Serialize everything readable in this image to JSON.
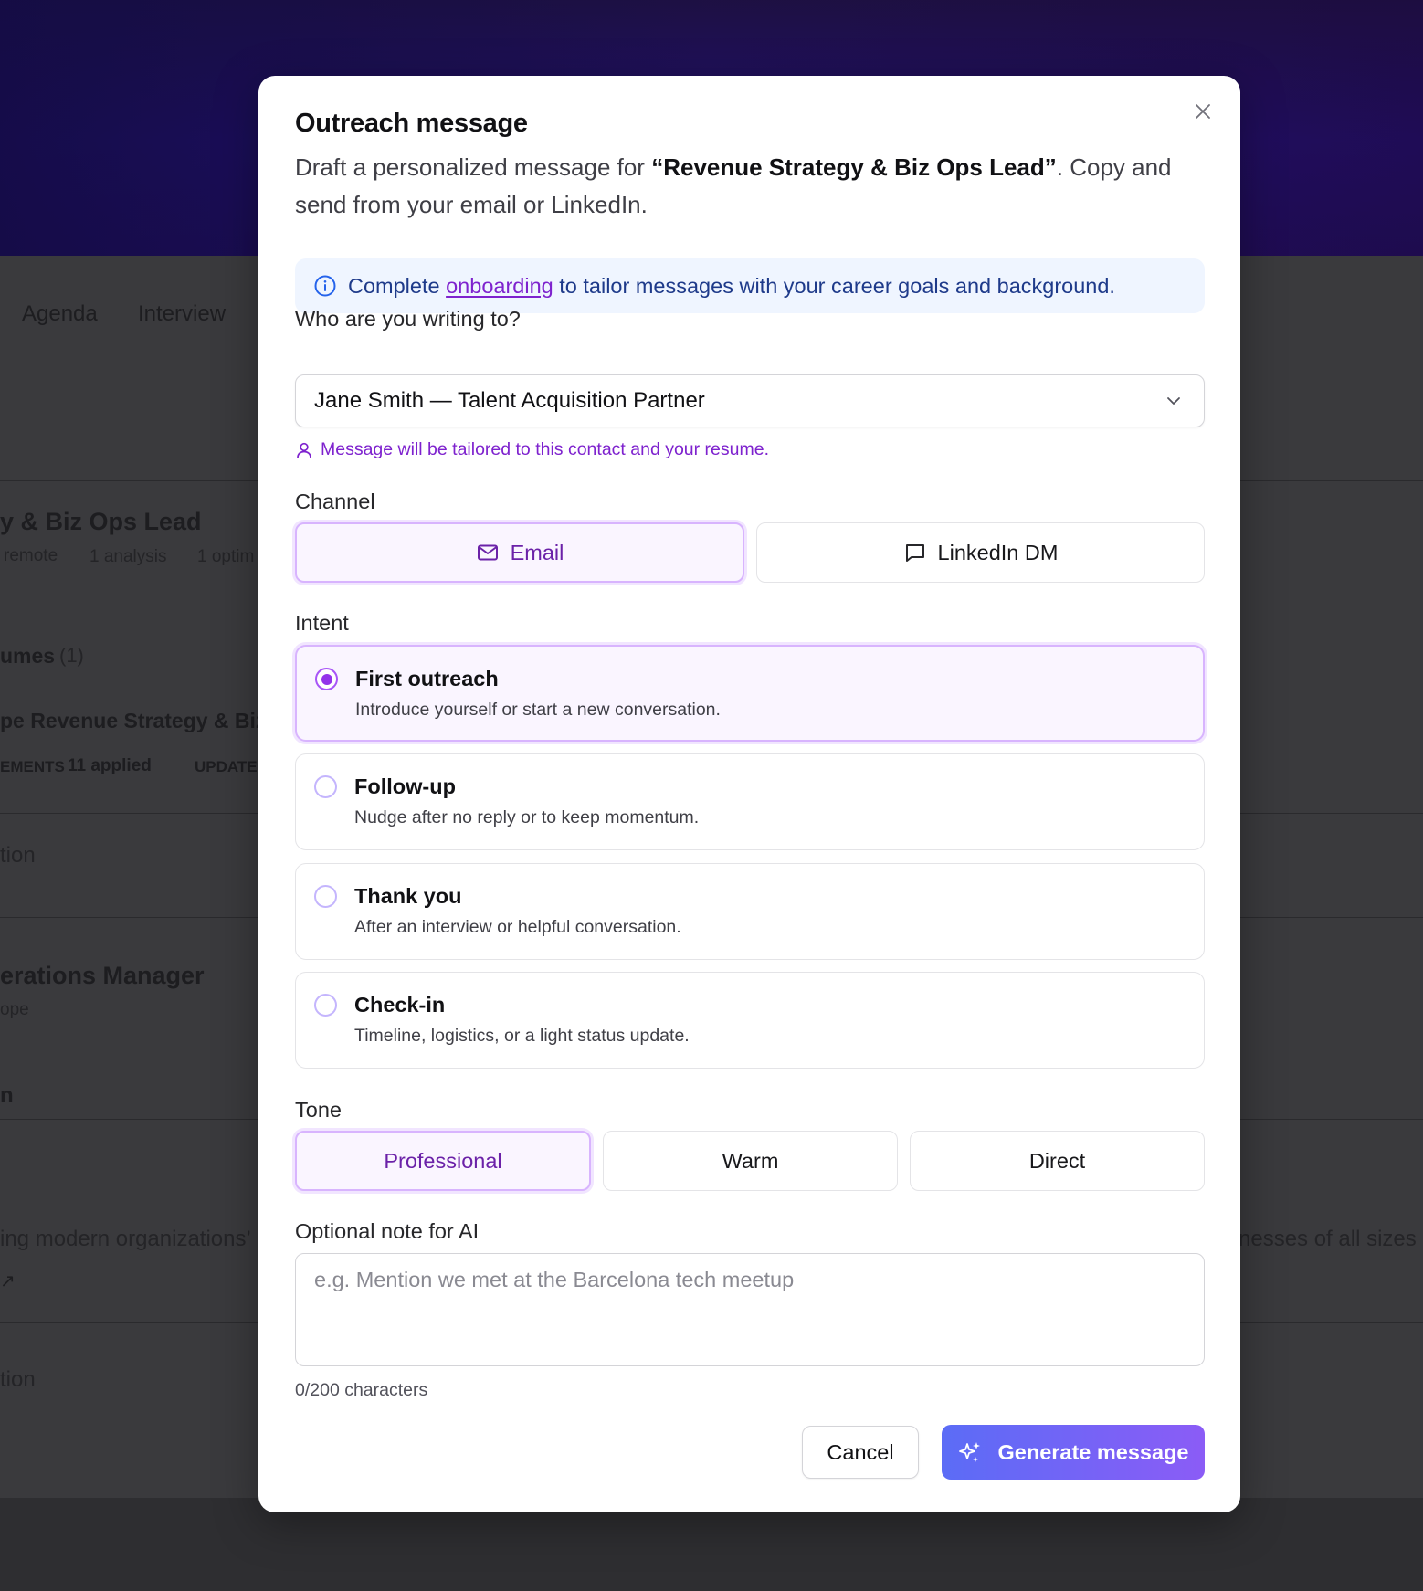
{
  "background": {
    "tabs": [
      "Agenda",
      "Interview"
    ],
    "job_title": "y & Biz Ops Lead",
    "meta": [
      "remote",
      "1 analysis",
      "1 optim"
    ],
    "resumes_heading": "umes",
    "resumes_count": "(1)",
    "resume_title": "pe Revenue Strategy & Biz",
    "enhancements_label": "EMENTS",
    "enhancements_value": "11 applied",
    "updated_label": "UPDATE",
    "section_a": "tion",
    "role2_title": "erations Manager",
    "role2_sub": "ope",
    "section_b": "n",
    "blurb_left": "ing modern organizations’",
    "blurb_right": "nesses of all sizes",
    "section_c": "tion"
  },
  "modal": {
    "title": "Outreach message",
    "description_pre": "Draft a personalized message for ",
    "description_role": "“Revenue Strategy & Biz Ops Lead”",
    "description_post": ". Copy and send from your email or LinkedIn.",
    "info": {
      "pre": "Complete ",
      "link": "onboarding",
      "post": " to tailor messages with your career goals and background."
    },
    "recipient": {
      "label": "Who are you writing to?",
      "value": "Jane Smith — Talent Acquisition Partner",
      "hint": "Message will be tailored to this contact and your resume."
    },
    "channel": {
      "label": "Channel",
      "options": [
        {
          "label": "Email",
          "icon": "mail-icon",
          "selected": true
        },
        {
          "label": "LinkedIn DM",
          "icon": "message-square-icon",
          "selected": false
        }
      ]
    },
    "intent": {
      "label": "Intent",
      "options": [
        {
          "title": "First outreach",
          "desc": "Introduce yourself or start a new conversation.",
          "selected": true
        },
        {
          "title": "Follow-up",
          "desc": "Nudge after no reply or to keep momentum.",
          "selected": false
        },
        {
          "title": "Thank you",
          "desc": "After an interview or helpful conversation.",
          "selected": false
        },
        {
          "title": "Check-in",
          "desc": "Timeline, logistics, or a light status update.",
          "selected": false
        }
      ]
    },
    "tone": {
      "label": "Tone",
      "options": [
        {
          "label": "Professional",
          "selected": true
        },
        {
          "label": "Warm",
          "selected": false
        },
        {
          "label": "Direct",
          "selected": false
        }
      ]
    },
    "note": {
      "label": "Optional note for AI",
      "placeholder": "e.g. Mention we met at the Barcelona tech meetup",
      "value": "",
      "counter": "0/200 characters"
    },
    "actions": {
      "cancel": "Cancel",
      "generate": "Generate message"
    }
  },
  "colors": {
    "accent": "#9333ea",
    "accent_light": "#faf5ff",
    "info_bg": "#eff5ff",
    "info_text": "#1e3a8a",
    "generate_gradient_start": "#5b6cf6",
    "generate_gradient_end": "#8b5cf6"
  }
}
